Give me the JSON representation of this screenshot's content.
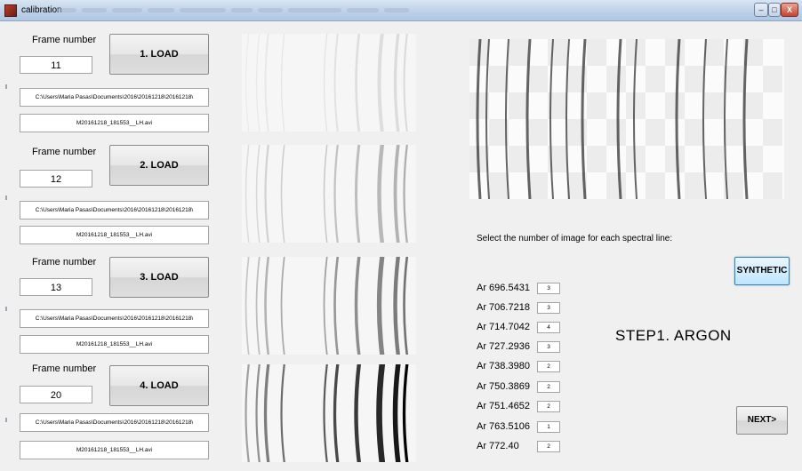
{
  "window": {
    "title": "calibration",
    "controls": {
      "minimize": "–",
      "maximize": "□",
      "close": "X"
    }
  },
  "icons": {
    "app": "matlab-figure-icon"
  },
  "load_panels": [
    {
      "frame_label": "Frame number",
      "frame_value": "11",
      "load_label": "1. LOAD",
      "path": "C:\\Users\\Maria Pasas\\Documents\\2016\\20161218\\20161218\\",
      "file": "M20161218_181553__LH.avi",
      "image_name": "frame-image-1",
      "intensity": 0.12
    },
    {
      "frame_label": "Frame number",
      "frame_value": "12",
      "load_label": "2. LOAD",
      "path": "C:\\Users\\Maria Pasas\\Documents\\2016\\20161218\\20161218\\",
      "file": "M20161218_181553__LH.avi",
      "image_name": "frame-image-2",
      "intensity": 0.3
    },
    {
      "frame_label": "Frame number",
      "frame_value": "13",
      "load_label": "3. LOAD",
      "path": "C:\\Users\\Maria Pasas\\Documents\\2016\\20161218\\20161218\\",
      "file": "M20161218_181553__LH.avi",
      "image_name": "frame-image-3",
      "intensity": 0.55
    },
    {
      "frame_label": "Frame number",
      "frame_value": "20",
      "load_label": "4. LOAD",
      "path": "C:\\Users\\Maria Pasas\\Documents\\2016\\20161218\\20161218\\",
      "file": "M20161218_181553__LH.avi",
      "image_name": "frame-image-4",
      "intensity": 1.0
    }
  ],
  "spectral": {
    "prompt": "Select the number of image for each spectral line:",
    "lines": [
      {
        "label": "Ar 696.5431",
        "value": "3"
      },
      {
        "label": "Ar 706.7218",
        "value": "3"
      },
      {
        "label": "Ar 714.7042",
        "value": "4"
      },
      {
        "label": "Ar 727.2936",
        "value": "3"
      },
      {
        "label": "Ar 738.3980",
        "value": "2"
      },
      {
        "label": "Ar 750.3869",
        "value": "2"
      },
      {
        "label": "Ar 751.4652",
        "value": "2"
      },
      {
        "label": "Ar 763.5106",
        "value": "1"
      },
      {
        "label": "Ar 772.40",
        "value": "2"
      }
    ]
  },
  "synthetic_label": "SYNTHETIC",
  "step_title": "STEP1. ARGON",
  "next_label": "NEXT>",
  "colors": {
    "accent_border": "#3c7fb1",
    "accent_fill": "#bee6fd",
    "titlebar": "#bcd0e8"
  }
}
